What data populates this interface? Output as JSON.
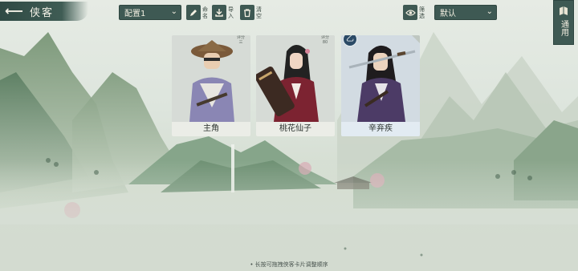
{
  "header": {
    "back_label": "侠客",
    "config_select": "配置1",
    "tools": [
      {
        "name": "rename",
        "label": "命名"
      },
      {
        "name": "import",
        "label": "导入"
      },
      {
        "name": "clear",
        "label": "清空"
      }
    ],
    "filter_label": "筛选",
    "sort_select": "默认"
  },
  "side_tab": {
    "label": "通用"
  },
  "cards": [
    {
      "name": "主角",
      "grade": "评分 三",
      "grade_badge": "",
      "selected": false
    },
    {
      "name": "桃花仙子",
      "grade": "评分 80",
      "grade_badge": "",
      "selected": false
    },
    {
      "name": "辛弃疾",
      "grade": "",
      "grade_badge": "乙",
      "selected": true
    }
  ],
  "hint": "长按可拖拽侠客卡片调整顺序",
  "colors": {
    "ui_dark": "#3e5953",
    "card_bg": "#d9ddd8",
    "selected_card": "#c8d4dd"
  }
}
